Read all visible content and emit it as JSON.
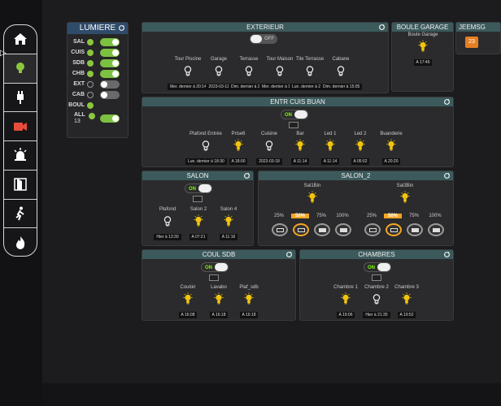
{
  "nav": [
    "home-icon",
    "bulb-icon",
    "plug-icon",
    "camera-icon",
    "alarm-icon",
    "door-icon",
    "motion-icon",
    "fire-icon"
  ],
  "lumiere": {
    "title": "LUMIERE",
    "rows": [
      {
        "label": "SAL",
        "dot": "on",
        "switch": "on"
      },
      {
        "label": "CUIS",
        "dot": "on",
        "switch": "on"
      },
      {
        "label": "SDB",
        "dot": "on",
        "switch": "on"
      },
      {
        "label": "CHB",
        "dot": "on",
        "switch": "on"
      },
      {
        "label": "EXT",
        "dot": "off",
        "switch": "off"
      },
      {
        "label": "CAB",
        "dot": "off",
        "switch": "off"
      },
      {
        "label": "BOUL",
        "dot": "on",
        "switch": "none"
      }
    ],
    "all_label": "ALL",
    "all_count": "13"
  },
  "exterieur": {
    "title": "EXTERIEUR",
    "switch_label": "OFF",
    "devices": [
      {
        "name": "Tour Piscine",
        "status": "Mer. dernier à 20:14",
        "on": false
      },
      {
        "name": "Garage",
        "status": "2023-03-11",
        "on": false
      },
      {
        "name": "Terrasse",
        "status": "Dim. dernier à 21:56",
        "on": false
      },
      {
        "name": "Tour Maison",
        "status": "Mer. dernier à 19:56",
        "on": false
      },
      {
        "name": "Tite Terrasse",
        "status": "Lun. dernier à 22:08",
        "on": false
      },
      {
        "name": "Cabane",
        "status": "Dim. dernier à 15:05",
        "on": false
      }
    ]
  },
  "boule_garage": {
    "title": "BOULE GARAGE",
    "devices": [
      {
        "name": "Boule Garage",
        "status": "A 17:46",
        "on": true
      }
    ]
  },
  "jeemsg": {
    "title": "JEEMSG",
    "badge": "23"
  },
  "entr": {
    "title": "ENTR CUIS BUAN",
    "switch_label": "ON",
    "devices": [
      {
        "name": "Plafond Entrée",
        "status": "Lun. dernier à 18:30",
        "on": false
      },
      {
        "name": "Prise6",
        "status": "A 18:00",
        "on": true
      },
      {
        "name": "Cuisine",
        "status": "2023-03-18",
        "on": false
      },
      {
        "name": "Bar",
        "status": "A 11:14",
        "on": true
      },
      {
        "name": "Led 1",
        "status": "A 11:14",
        "on": true
      },
      {
        "name": "Led 2",
        "status": "A 05:02",
        "on": true
      },
      {
        "name": "Buanderie",
        "status": "A 20:20",
        "on": true
      }
    ]
  },
  "salon": {
    "title": "SALON",
    "switch_label": "ON",
    "devices": [
      {
        "name": "Plafond",
        "status": "Hier à 13:30",
        "on": false
      },
      {
        "name": "Salon 2",
        "status": "A 07:21",
        "on": true
      },
      {
        "name": "Salon 4",
        "status": "A 11:16",
        "on": true
      }
    ]
  },
  "salon2": {
    "title": "SALON_2",
    "groups": [
      {
        "name": "Sal1Bin",
        "levels": [
          "25%",
          "50%",
          "75%",
          "100%"
        ],
        "selected": "50%"
      },
      {
        "name": "Sal3Bin",
        "levels": [
          "25%",
          "50%",
          "75%",
          "100%"
        ],
        "selected": "50%"
      }
    ]
  },
  "coul": {
    "title": "COUL SDB",
    "switch_label": "ON",
    "devices": [
      {
        "name": "Couloir",
        "status": "A 16:08",
        "on": true
      },
      {
        "name": "Lavabo",
        "status": "A 16:18",
        "on": true
      },
      {
        "name": "Plaf_sdb",
        "status": "A 16:18",
        "on": true
      }
    ]
  },
  "chambres": {
    "title": "CHAMBRES",
    "switch_label": "ON",
    "devices": [
      {
        "name": "Chambre 1",
        "status": "A 19:06",
        "on": true
      },
      {
        "name": "Chambre 2",
        "status": "Hier à 21:35",
        "on": false
      },
      {
        "name": "Chambre 3",
        "status": "A 19:52",
        "on": true
      }
    ]
  }
}
